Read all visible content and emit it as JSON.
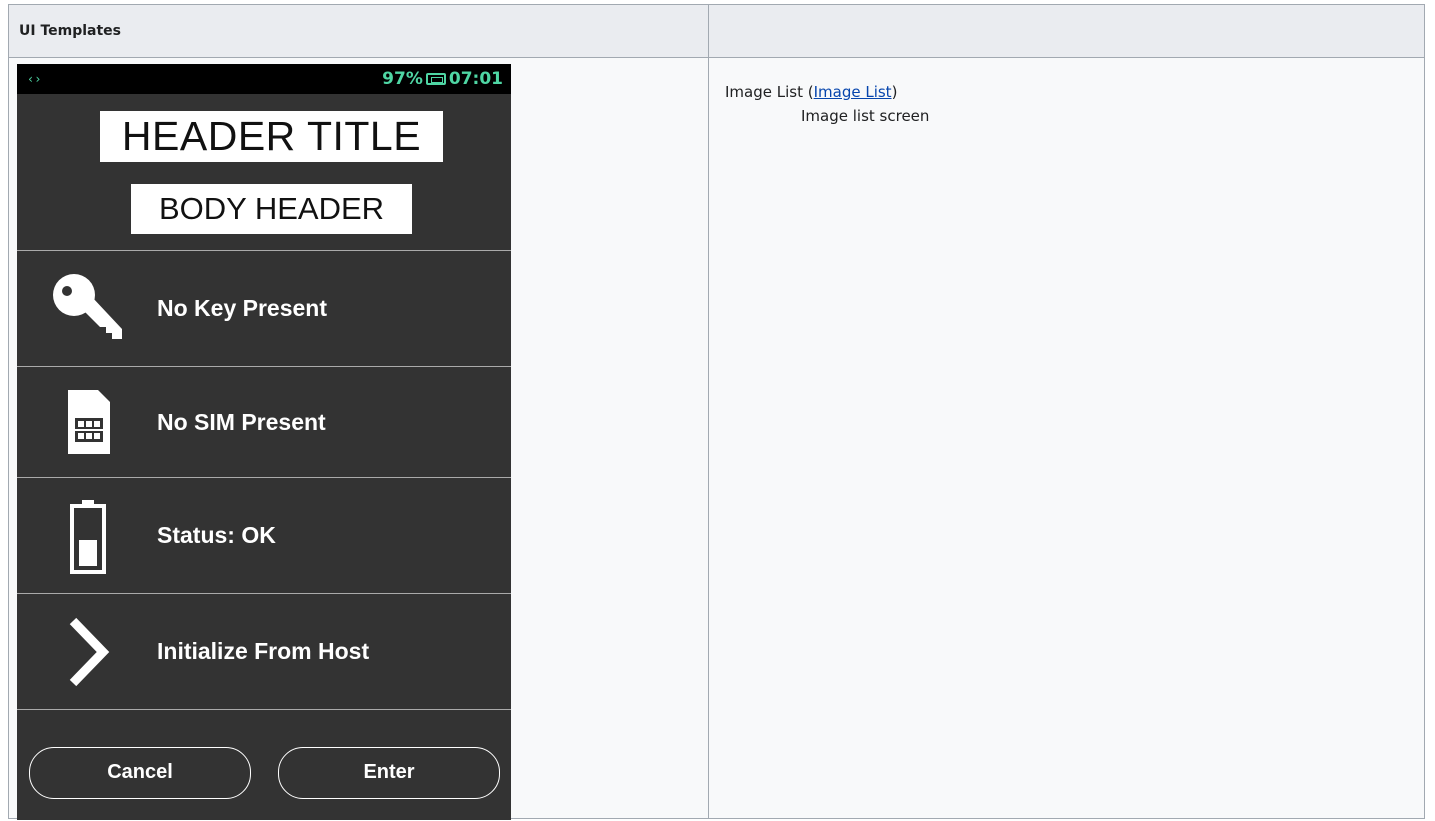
{
  "table": {
    "header_left": "UI Templates",
    "header_right": ""
  },
  "device": {
    "status": {
      "left_symbol": "‹›",
      "battery": "97%",
      "time": "07:01"
    },
    "header_title": "HEADER TITLE",
    "body_header": "BODY HEADER",
    "items": [
      {
        "label": "No Key Present",
        "icon": "key-icon"
      },
      {
        "label": "No SIM Present",
        "icon": "sim-card-icon"
      },
      {
        "label": "Status: OK",
        "icon": "battery-icon"
      },
      {
        "label": "Initialize From Host",
        "icon": "chevron-right-icon"
      }
    ],
    "buttons": {
      "cancel": "Cancel",
      "enter": "Enter"
    }
  },
  "description": {
    "name": "Image List",
    "open_paren": " (",
    "link": "Image List",
    "close_paren": ")",
    "text": "Image list screen"
  }
}
